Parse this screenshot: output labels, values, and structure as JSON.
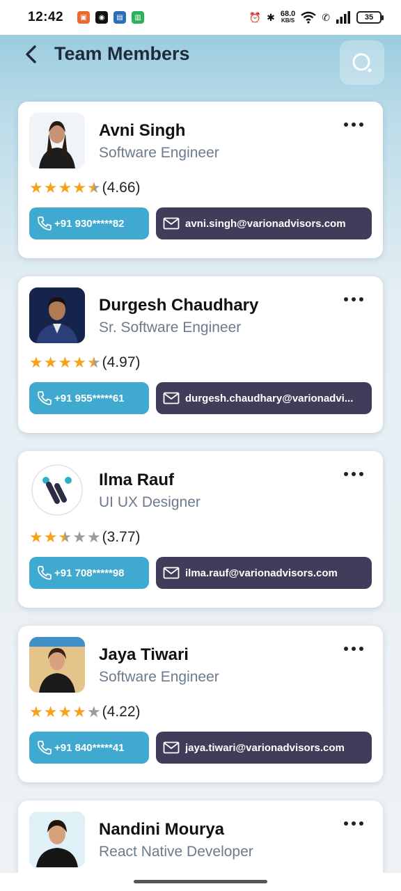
{
  "status_bar": {
    "time": "12:42",
    "net_speed": "68.0",
    "net_unit": "KB/S",
    "battery": "35"
  },
  "header": {
    "title": "Team Members"
  },
  "members": [
    {
      "name": "Avni Singh",
      "role": "Software Engineer",
      "rating_value": 4.66,
      "rating_label": "(4.66)",
      "phone": "+91 930*****82",
      "email": "avni.singh@varionadvisors.com"
    },
    {
      "name": "Durgesh Chaudhary",
      "role": "Sr. Software Engineer",
      "rating_value": 4.97,
      "rating_label": "(4.97)",
      "phone": "+91 955*****61",
      "email": "durgesh.chaudhary@varionadvi..."
    },
    {
      "name": "Ilma Rauf",
      "role": "UI UX Designer",
      "rating_value": 3.77,
      "rating_label": "(3.77)",
      "phone": "+91 708*****98",
      "email": "ilma.rauf@varionadvisors.com"
    },
    {
      "name": "Jaya Tiwari",
      "role": "Software Engineer",
      "rating_value": 4.22,
      "rating_label": "(4.22)",
      "phone": "+91 840*****41",
      "email": "jaya.tiwari@varionadvisors.com"
    },
    {
      "name": "Nandini Mourya",
      "role": "React Native Developer"
    }
  ],
  "colors": {
    "phone_button": "#3fa9cf",
    "email_button": "#3f3d59",
    "star_filled": "#f6a21a",
    "star_empty": "#9b9b9b"
  }
}
